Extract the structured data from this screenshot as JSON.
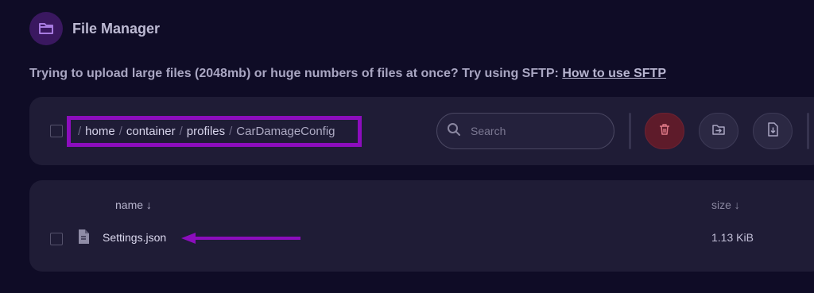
{
  "header": {
    "title": "File Manager",
    "icon": "folder-icon"
  },
  "notice": {
    "text": "Trying to upload large files (2048mb) or huge numbers of files at once? Try using SFTP: ",
    "link": "How to use SFTP"
  },
  "breadcrumb": {
    "separator": "/",
    "segments": [
      "home",
      "container",
      "profiles",
      "CarDamageConfig"
    ]
  },
  "search": {
    "placeholder": "Search"
  },
  "actions": {
    "delete_icon": "trash-icon",
    "move_icon": "move-file-icon",
    "download_icon": "file-download-icon"
  },
  "table": {
    "columns": [
      {
        "label": "name",
        "sort": "↓"
      },
      {
        "label": "size",
        "sort": "↓"
      }
    ],
    "rows": [
      {
        "name": "Settings.json",
        "size": "1.13 KiB",
        "icon": "file-icon"
      }
    ]
  },
  "colors": {
    "accent": "#8c0dbd",
    "background": "#0f0c26",
    "panel": "#1f1c36",
    "delete": "#5e1b2a"
  }
}
